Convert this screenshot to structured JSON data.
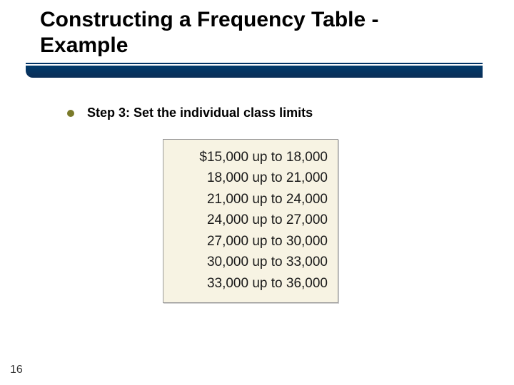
{
  "title_line1": "Constructing a Frequency Table -",
  "title_line2": "Example",
  "bullet": {
    "text": "Step 3: Set the individual class limits"
  },
  "class_limits": {
    "rows": [
      "$15,000 up to 18,000",
      "18,000 up to 21,000",
      "21,000 up to 24,000",
      "24,000 up to 27,000",
      "27,000 up to 30,000",
      "30,000 up to 33,000",
      "33,000 up to 36,000"
    ]
  },
  "page_number": "16"
}
